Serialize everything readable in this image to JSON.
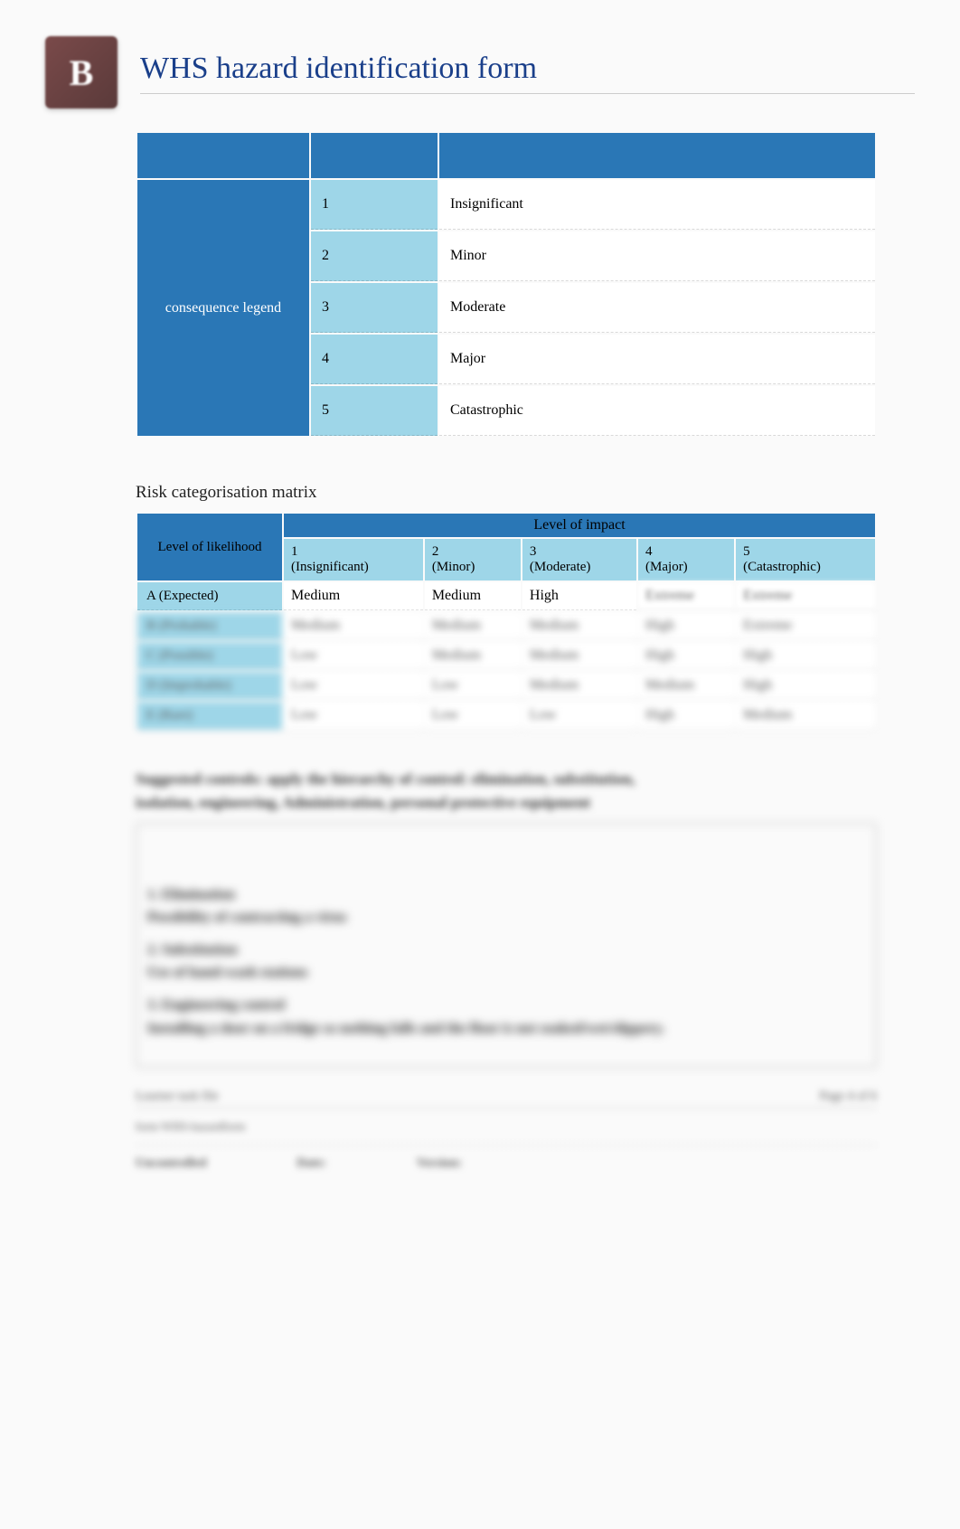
{
  "header": {
    "logo_text": "B",
    "title": "WHS hazard identification form"
  },
  "consequence": {
    "label": "consequence legend",
    "rows": [
      {
        "n": "1",
        "desc": "Insignificant"
      },
      {
        "n": "2",
        "desc": "Minor"
      },
      {
        "n": "3",
        "desc": "Moderate"
      },
      {
        "n": "4",
        "desc": "Major"
      },
      {
        "n": "5",
        "desc": "Catastrophic"
      }
    ]
  },
  "matrix": {
    "title": "Risk categorisation matrix",
    "likelihood_head": "Level of likelihood",
    "impact_head": "Level of impact",
    "impact_cols": [
      {
        "n": "1",
        "d": "(Insignificant)"
      },
      {
        "n": "2",
        "d": "(Minor)"
      },
      {
        "n": "3",
        "d": "(Moderate)"
      },
      {
        "n": "4",
        "d": "(Major)"
      },
      {
        "n": "5",
        "d": "(Catastrophic)"
      }
    ],
    "rows": [
      {
        "label": "A (Expected)",
        "cells": [
          "Medium",
          "Medium",
          "High",
          "Extreme",
          "Extreme"
        ]
      },
      {
        "label": "B (Probable)",
        "cells": [
          "Medium",
          "Medium",
          "Medium",
          "High",
          "Extreme"
        ]
      },
      {
        "label": "C (Possible)",
        "cells": [
          "Low",
          "Medium",
          "Medium",
          "High",
          "High"
        ]
      },
      {
        "label": "D (Improbable)",
        "cells": [
          "Low",
          "Low",
          "Medium",
          "Medium",
          "High"
        ]
      },
      {
        "label": "E (Rare)",
        "cells": [
          "Low",
          "Low",
          "Low",
          "High",
          "Medium"
        ]
      }
    ]
  },
  "controls": {
    "prompt_l1": "Suggested controls: apply the hierarchy of control: elimination, substitution,",
    "prompt_l2": "isolation, engineering, Administration, personal protective equipment",
    "b1_title": "1. Elimination",
    "b1_text": "Possibility of contracting a virus",
    "b2_title": "2. Substitution",
    "b2_text": "Use of hand-wash stations",
    "b3_title": "3. Engineering control",
    "b3_text": "Installing a door on a fridge so nothing falls and the floor is not soaked/wet/slippery."
  },
  "footer": {
    "left": "Learner task file",
    "right": "Page 4 of 6",
    "line2": "form WHS-hazardform",
    "uncontrolled": "Uncontrolled",
    "date": "Date:",
    "version": "Version:"
  }
}
